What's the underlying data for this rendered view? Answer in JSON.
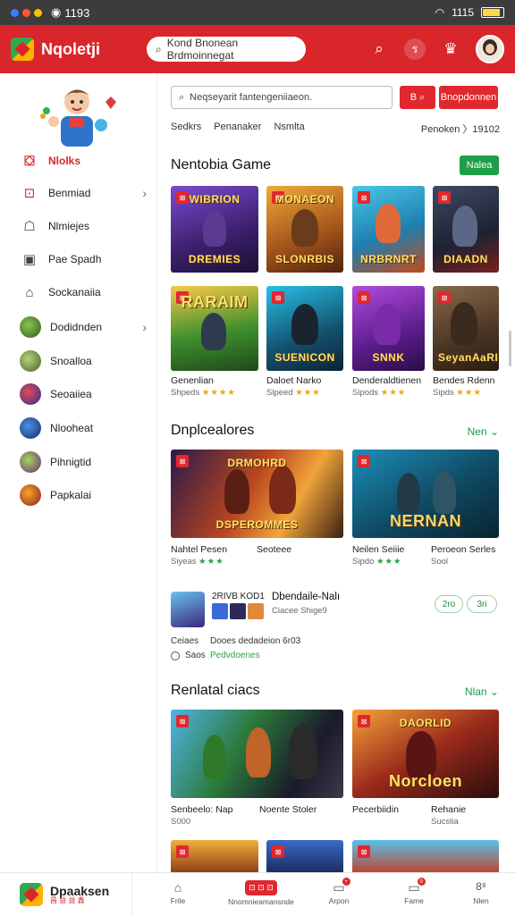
{
  "status_bar": {
    "time": "1193",
    "signal_text": "1115",
    "battery_level": 0.8
  },
  "app_bar": {
    "brand": "Nqoletji",
    "search_text": "Kond Bnonean Brdmoinnegat",
    "icons": [
      "search-icon",
      "refresh-icon",
      "trophy-icon",
      "profile-avatar"
    ],
    "refresh_label": "ร"
  },
  "sidebar": {
    "items": [
      {
        "label": "Nlolks",
        "icon": "home-icon",
        "active": true
      },
      {
        "label": "Benmiad",
        "icon": "download-icon",
        "chevron": true
      },
      {
        "label": "Nlmiejes",
        "icon": "gamepad-icon"
      },
      {
        "label": "Pae Spadh",
        "icon": "screen-icon"
      },
      {
        "label": "Sockanaiia",
        "icon": "house-icon"
      },
      {
        "label": "Dodidnden",
        "icon": "game-avatar-1",
        "chevron": true
      },
      {
        "label": "Snoalloa",
        "icon": "game-avatar-2"
      },
      {
        "label": "Seoaiiea",
        "icon": "game-avatar-3"
      },
      {
        "label": "Nlooheat",
        "icon": "game-avatar-4"
      },
      {
        "label": "Pihnigtid",
        "icon": "game-avatar-5"
      },
      {
        "label": "Papkalai",
        "icon": "game-avatar-6"
      }
    ]
  },
  "main": {
    "search_placeholder": "Neqseyarit fantengeniiaeon.",
    "btn_search_label": "B",
    "btn_promo_label": "Bnopdonnen",
    "filters": [
      "Sedkrs",
      "Penanaker",
      "Nsmlta"
    ],
    "sort_label": "Penoken 〉19102",
    "section1": {
      "title": "Nentobia Game",
      "action": "Nalea"
    },
    "tiles_row1": [
      {
        "title": "DREMIES",
        "top": "WIBRION"
      },
      {
        "title": "SLONRBIS",
        "top": "MONAEON"
      },
      {
        "title": "NRBRNRT",
        "top": ""
      },
      {
        "title": "DIAADN",
        "top": ""
      }
    ],
    "tiles_row2": [
      {
        "title": "",
        "top": "RARAIM"
      },
      {
        "title": "SUENICON",
        "top": ""
      },
      {
        "title": "SNNK",
        "top": ""
      },
      {
        "title": "SeyanAaRI",
        "top": ""
      }
    ],
    "tiles_row2_captions": [
      {
        "name": "Genenlian",
        "meta": "Shpeds",
        "stars": "★★★★"
      },
      {
        "name": "Daloet Narko",
        "meta": "Slpeed",
        "stars": "★★★"
      },
      {
        "name": "Denderaldtienen",
        "meta": "Sipods",
        "stars": "★★★"
      },
      {
        "name": "Bendes Rdenn",
        "meta": "Sipds",
        "stars": "★★★"
      }
    ],
    "section2": {
      "title": "Dnplcealores",
      "action": "Nen ⌄"
    },
    "wide_tiles": [
      {
        "title": "DSPEROMMES",
        "top": "DRMOHRD"
      },
      {
        "title": "NERNAN",
        "top": ""
      }
    ],
    "wide_captions": [
      {
        "name": "Nahtel Pesen",
        "meta": "Siyeas",
        "stars": "★★★",
        "extra": "Seoteee"
      },
      {
        "name": "Neilen Seiiie",
        "meta": "Sipdo",
        "stars": "★★★",
        "extra": "Peroeon Serles",
        "extra2": "Sool"
      }
    ],
    "promo_row": {
      "badge_text": "2RIVB KOD1",
      "title": "Dbendaile-Nalı",
      "subtitle": "Ciacee Shige9",
      "line1_a": "Ceiaes",
      "line1_b": "Dooes dedadeion 6r03",
      "line2_a": "Saos",
      "line2_b": "Pedvdoenes",
      "pill1": "2ro",
      "pill2": "3ri"
    },
    "section3": {
      "title": "Renlatal ciacs",
      "action": "Nlan ⌄"
    },
    "wide_tiles2": [
      {
        "title": "",
        "top": ""
      },
      {
        "title": "Norcloen",
        "top": "DAORLID"
      }
    ],
    "wide_captions2": [
      {
        "name": "Senbeelo: Nap",
        "meta": "S000",
        "extra": "Noente Stoler"
      },
      {
        "name": "Pecerbiidin",
        "meta": "",
        "extra": "Rehanie",
        "extra2": "Sucslia"
      }
    ]
  },
  "bottom_bar": {
    "brand": "Dpaaksen",
    "brand_sub": "昌 益 益 鑫",
    "items": [
      {
        "label": "Frile",
        "icon": "home-icon"
      },
      {
        "label": "Nnomnieamansnde",
        "icon": "controller-icon"
      },
      {
        "label": "Arpon",
        "icon": "clipboard-icon",
        "notif": "•"
      },
      {
        "label": "Fame",
        "icon": "bell-icon",
        "notif": "9"
      },
      {
        "label": "Nlen",
        "icon": "grid-icon",
        "glyph": "8⁸"
      }
    ]
  }
}
